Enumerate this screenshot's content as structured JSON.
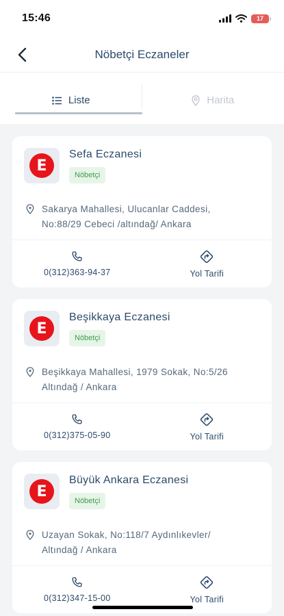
{
  "status_bar": {
    "time": "15:46",
    "battery": "17"
  },
  "header": {
    "title": "Nöbetçi Eczaneler"
  },
  "tabs": [
    {
      "label": "Liste",
      "icon": "list-icon",
      "active": true
    },
    {
      "label": "Harita",
      "icon": "map-pin-icon",
      "active": false
    }
  ],
  "pharmacies": [
    {
      "name": "Sefa Eczanesi",
      "badge": "Nöbetçi",
      "address_line1": "Sakarya Mahallesi, Ulucanlar Caddesi,",
      "address_line2": "No:88/29 Cebeci /altındağ/ Ankara",
      "phone": "0(312)363-94-37",
      "directions": "Yol Tarifi"
    },
    {
      "name": "Beşikkaya Eczanesi",
      "badge": "Nöbetçi",
      "address_line1": "Beşikkaya Mahallesi, 1979 Sokak, No:5/26",
      "address_line2": "Altındağ / Ankara",
      "phone": "0(312)375-05-90",
      "directions": "Yol Tarifi"
    },
    {
      "name": "Büyük Ankara Eczanesi",
      "badge": "Nöbetçi",
      "address_line1": "Uzayan Sokak, No:118/7 Aydınlıkevler/",
      "address_line2": "Altındağ / Ankara",
      "phone": "0(312)347-15-00",
      "directions": "Yol Tarifi"
    }
  ],
  "colors": {
    "primary_text": "#2b4a6a",
    "badge_bg": "#e6f5e7",
    "badge_text": "#3f9a4f",
    "logo_red": "#e8141b"
  }
}
